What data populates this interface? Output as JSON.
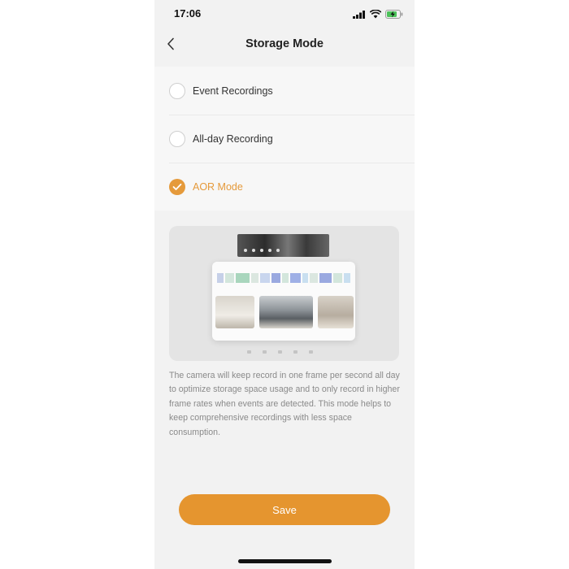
{
  "status_bar": {
    "time": "17:06"
  },
  "header": {
    "title": "Storage Mode",
    "back_icon": "chevron-left-icon"
  },
  "options": [
    {
      "label": "Event Recordings",
      "selected": false
    },
    {
      "label": "All-day Recording",
      "selected": false
    },
    {
      "label": "AOR Mode",
      "selected": true
    }
  ],
  "description": "The camera will keep record in one frame per second all day to optimize storage space usage and to only record in higher frame rates when events are detected. This mode helps to keep comprehensive recordings with less space consumption.",
  "save_label": "Save",
  "colors": {
    "accent": "#e59a3b",
    "button": "#e5952f",
    "background": "#f2f2f2"
  }
}
